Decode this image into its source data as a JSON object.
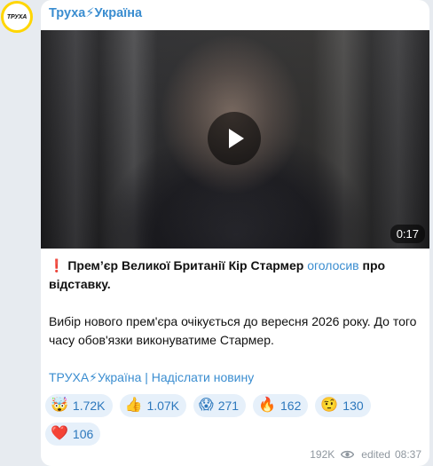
{
  "avatar": {
    "text": "ТРУХА"
  },
  "channel": {
    "name": "Труха⚡Україна"
  },
  "video": {
    "duration": "0:17"
  },
  "post": {
    "alert_emoji": "❗",
    "headline_part1": "Прем’єр Великої Британії Кір Стармер ",
    "headline_link": "оголосив",
    "headline_part2": " про відставку.",
    "paragraph2": "Вибір нового прем'єра очікується до вересня 2026 року. До того часу обов'язки виконуватиме Стармер.",
    "signature_link1": "ТРУХА⚡Україна",
    "signature_separator": " | ",
    "signature_link2": "Надіслати новину"
  },
  "reactions": [
    {
      "emoji": "🤯",
      "count": "1.72K"
    },
    {
      "emoji": "👍",
      "count": "1.07K"
    },
    {
      "emoji": "😱",
      "count": "271"
    },
    {
      "emoji": "🔥",
      "count": "162"
    },
    {
      "emoji": "🤨",
      "count": "130"
    },
    {
      "emoji": "❤️",
      "count": "106"
    }
  ],
  "meta": {
    "views": "192K",
    "edited_label": "edited",
    "time": "08:37"
  },
  "colors": {
    "accent": "#3a8dd0",
    "reaction_bg": "#e6f0fa",
    "avatar_ring": "#ffd600"
  }
}
